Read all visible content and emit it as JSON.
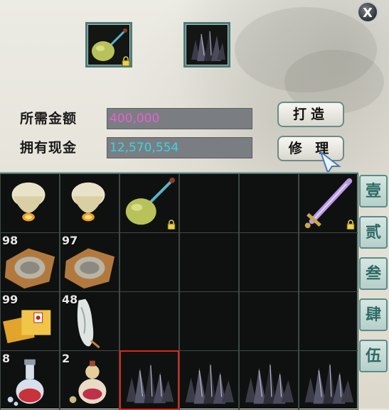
{
  "close_label": "X",
  "top_slots": [
    {
      "name": "gourd-bomb-slot",
      "item": "gourd-bomb",
      "locked": true
    },
    {
      "name": "black-crystal-ore-slot",
      "item": "black-crystal-ore",
      "locked": false
    }
  ],
  "cost": {
    "required_label": "所需金额",
    "required_value": "400,000",
    "required_color": "#e85fd2",
    "owned_label": "拥有现金",
    "owned_value": "12,570,554",
    "owned_color": "#35d6e8"
  },
  "buttons": {
    "forge_label": "打造",
    "repair_label": "修 理"
  },
  "tabs": [
    "壹",
    "贰",
    "叁",
    "肆",
    "伍"
  ],
  "inventory": [
    {
      "item": "sky-lantern",
      "count": ""
    },
    {
      "item": "sky-lantern",
      "count": ""
    },
    {
      "item": "gourd-bomb",
      "count": "",
      "locked": true
    },
    {
      "item": "",
      "count": ""
    },
    {
      "item": "",
      "count": ""
    },
    {
      "item": "purple-sword",
      "count": "",
      "locked": true
    },
    {
      "item": "scroll-bundle",
      "count": "98"
    },
    {
      "item": "scroll-bundle",
      "count": "97"
    },
    {
      "item": "",
      "count": ""
    },
    {
      "item": "",
      "count": ""
    },
    {
      "item": "",
      "count": ""
    },
    {
      "item": "",
      "count": ""
    },
    {
      "item": "talisman-papers",
      "count": "99"
    },
    {
      "item": "jade-pendant",
      "count": "48"
    },
    {
      "item": "",
      "count": ""
    },
    {
      "item": "",
      "count": ""
    },
    {
      "item": "",
      "count": ""
    },
    {
      "item": "",
      "count": ""
    },
    {
      "item": "potion-flask",
      "count": "8"
    },
    {
      "item": "medicine-gourd",
      "count": "2"
    },
    {
      "item": "black-crystal-ore",
      "count": "",
      "selected": true
    },
    {
      "item": "black-crystal-ore",
      "count": ""
    },
    {
      "item": "black-crystal-ore",
      "count": ""
    },
    {
      "item": "black-crystal-ore",
      "count": ""
    }
  ]
}
